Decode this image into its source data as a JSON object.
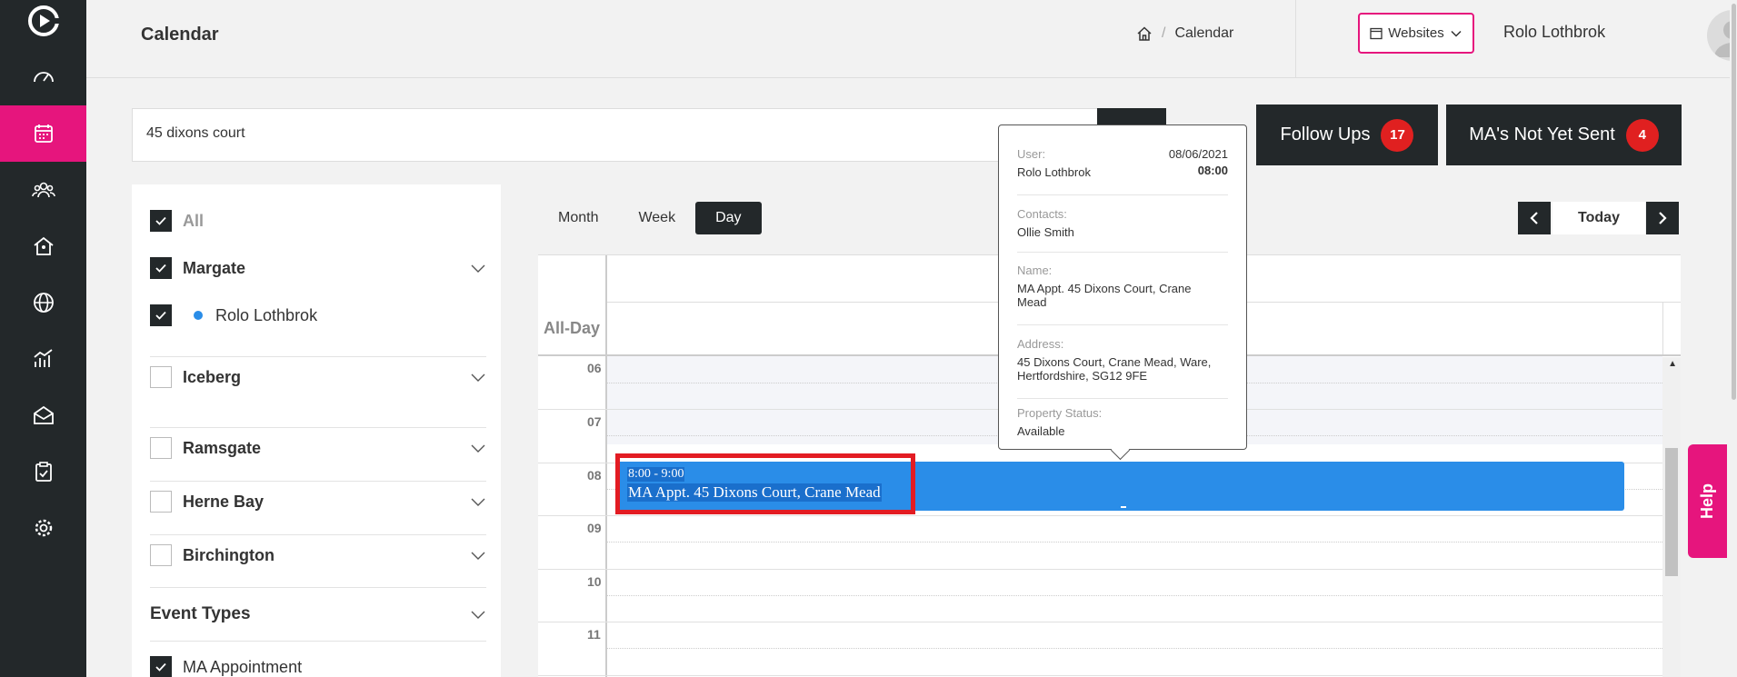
{
  "header": {
    "title": "Calendar",
    "breadcrumb": [
      "Calendar"
    ],
    "websites_label": "Websites",
    "user_name": "Rolo Lothbrok"
  },
  "search": {
    "value": "45 dixons court"
  },
  "actions": [
    {
      "label": "Follow Ups",
      "count": "17"
    },
    {
      "label": "MA's Not Yet Sent",
      "count": "4"
    }
  ],
  "filters": {
    "all_label": "All",
    "groups": [
      {
        "label": "Margate",
        "checked": true
      },
      {
        "label": "Rolo Lothbrok",
        "checked": true
      },
      {
        "label": "Iceberg",
        "checked": false
      },
      {
        "label": "Ramsgate",
        "checked": false
      },
      {
        "label": "Herne Bay",
        "checked": false
      },
      {
        "label": "Birchington",
        "checked": false
      }
    ],
    "event_types_label": "Event Types",
    "event_types": [
      {
        "label": "MA Appointment",
        "checked": true
      }
    ]
  },
  "calendar": {
    "views": [
      "Month",
      "Week",
      "Day"
    ],
    "active_view": "Day",
    "today_label": "Today",
    "allday_label": "All-Day",
    "hours": [
      "06",
      "07",
      "08",
      "09",
      "10",
      "11"
    ],
    "event": {
      "time": "8:00 - 9:00",
      "title": "MA Appt. 45 Dixons Court, Crane Mead",
      "color": "#2a8de8"
    }
  },
  "tooltip": {
    "user_label": "User:",
    "date": "08/06/2021",
    "user": "Rolo Lothbrok",
    "time": "08:00",
    "contacts_label": "Contacts:",
    "contacts": "Ollie Smith",
    "name_label": "Name:",
    "name_line1": "MA Appt. 45 Dixons Court, Crane",
    "name_line2": "Mead",
    "address_label": "Address:",
    "address_line1": "45 Dixons Court, Crane Mead, Ware,",
    "address_line2": "Hertfordshire, SG12 9FE",
    "status_label": "Property Status:",
    "status": "Available"
  },
  "help_label": "Help",
  "colors": {
    "brand": "#e6157d",
    "dark": "#23282a",
    "event": "#2a8de8",
    "badge": "#e02020"
  }
}
